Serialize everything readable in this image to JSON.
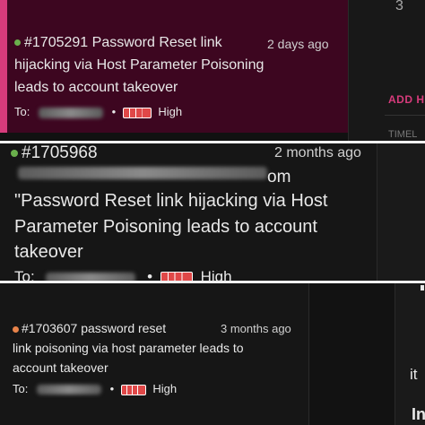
{
  "panel1": {
    "report_id": "#1705291",
    "title_line1": "Password Reset link",
    "title_line2": "hijacking via Host Parameter Poisoning",
    "title_line3": "leads to account takeover",
    "age": "2 days ago",
    "to_label": "To:",
    "bullet": "•",
    "severity": "High",
    "status_color": "#6ab04c",
    "bg_color": "#3d0620",
    "accent_color": "#d63b7b",
    "sidebar_number": "3",
    "sidebar_add": "ADD H",
    "sidebar_timeline": "TIMEL"
  },
  "panel2": {
    "report_id": "#1705968",
    "age": "2 months ago",
    "partial_text": "om",
    "title_line1": "\"Password Reset link hijacking via Host",
    "title_line2": "Parameter Poisoning leads to account",
    "title_line3": "takeover",
    "to_label": "To:",
    "bullet": "•",
    "severity": "High",
    "status_color": "#6ab04c"
  },
  "panel3": {
    "report_id": "#1703607",
    "title_line1": "password reset",
    "title_line2": "link poisoning via host parameter leads to",
    "title_line3": "account takeover",
    "age": "3 months ago",
    "to_label": "To:",
    "bullet": "•",
    "severity": "High",
    "status_color": "#e8834a",
    "side_text1": "it",
    "side_text2": "In"
  }
}
